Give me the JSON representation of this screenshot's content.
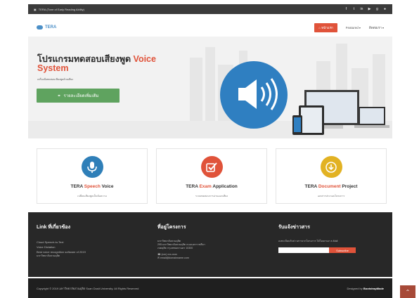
{
  "topbar": {
    "site_name": "TERA (Tone of Early Reading Ability)",
    "social_icons": [
      "facebook-icon",
      "twitter-icon",
      "linkedin-icon",
      "youtube-icon",
      "googleplus-icon",
      "rss-icon"
    ]
  },
  "nav": {
    "logo_text": "TERA",
    "home_label": "หน้าแรก",
    "features_label": "Featured",
    "contact_label": "ติดต่อเรา"
  },
  "hero": {
    "title_main": "โปรแกรมทดสอบเสียงพูด ",
    "title_accent_1": "Voice",
    "title_accent_2": "System",
    "subtitle": "เครื่องมือทดสอบเสียงพูดด้วยเสียง",
    "button_label": "รายละเอียดเพิ่มเติม"
  },
  "features": [
    {
      "title_prefix": "TERA ",
      "title_highlight": "Speech",
      "title_suffix": " Voice",
      "desc": "เปลี่ยนเสียงพูดเป็นข้อความ",
      "icon": "microphone-icon",
      "color": "#2f7fb8"
    },
    {
      "title_prefix": "TERA ",
      "title_highlight": "Exam",
      "title_suffix": " Application",
      "desc": "ระบบทดสอบการอ่านออกเสียง",
      "icon": "checkbox-icon",
      "color": "#e0533a"
    },
    {
      "title_prefix": "TERA ",
      "title_highlight": "Document",
      "title_suffix": " Project",
      "desc": "เอกสารประกอบโครงการ",
      "icon": "download-icon",
      "color": "#e2b223"
    }
  ],
  "footer": {
    "links_heading": "Link ที่เกี่ยวข้อง",
    "links": [
      "Cloud Speech-to-Text",
      "Voice Dictation",
      "Best voice recognition software of 2019",
      "มหาวิทยาลัยสวนดุสิต"
    ],
    "address_heading": "ที่อยู่โครงการ",
    "address_lines": [
      "มหาวิทยาลัยสวนดุสิต",
      "295 มหาวิทยาลัยสวนดุสิต ถนนนครราชสีมา",
      "เขตดุสิต กรุงเทพมหานคร 10300"
    ],
    "phone": "(xxx) xxx-xxxx",
    "email": "email@domainname.com",
    "news_heading": "รับแจ้งข่าวสาร",
    "news_text": "ลงทะเบียนรับข่าวสารจากโครงการ ได้โดยกรอก e-Mail",
    "subscribe_label": "Subscribe"
  },
  "copyright": {
    "text": "Copyright © 2019 มหาวิทยาลัยสวนดุสิต Suan Dusit University. All Rights Reserved",
    "designed_prefix": "Designed by ",
    "designed_by": "BootstrapMade"
  },
  "colors": {
    "accent": "#e0533a",
    "green": "#5fa35f",
    "dark": "#282828"
  }
}
